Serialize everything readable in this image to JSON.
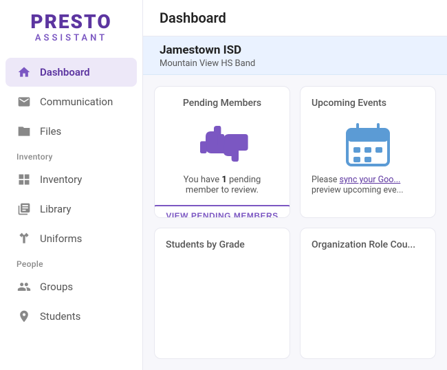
{
  "logo": {
    "name": "PRESTO",
    "sub": "ASSISTANT"
  },
  "sidebar": {
    "items": [
      {
        "id": "dashboard",
        "label": "Dashboard",
        "icon": "home",
        "active": true,
        "section": ""
      },
      {
        "id": "communication",
        "label": "Communication",
        "icon": "mail",
        "active": false,
        "section": ""
      },
      {
        "id": "files",
        "label": "Files",
        "icon": "folder",
        "active": false,
        "section": ""
      }
    ],
    "inventory_section": "Inventory",
    "inventory_items": [
      {
        "id": "inventory",
        "label": "Inventory",
        "icon": "grid"
      },
      {
        "id": "library",
        "label": "Library",
        "icon": "book"
      },
      {
        "id": "uniforms",
        "label": "Uniforms",
        "icon": "tshirt"
      }
    ],
    "people_section": "People",
    "people_items": [
      {
        "id": "groups",
        "label": "Groups",
        "icon": "users"
      },
      {
        "id": "students",
        "label": "Students",
        "icon": "student"
      }
    ]
  },
  "main": {
    "header_title": "Dashboard",
    "org_name": "Jamestown ISD",
    "org_sub": "Mountain View HS Band",
    "cards": [
      {
        "id": "pending-members",
        "title": "Pending Members",
        "pending_text_prefix": "You have ",
        "pending_count": "1",
        "pending_text_suffix": " pending member to review.",
        "button_label": "VIEW PENDING MEMBERS"
      },
      {
        "id": "upcoming-events",
        "title": "Upcoming Events",
        "sync_text": "Please ",
        "sync_link": "sync your Goo...",
        "sync_text2": "preview upcoming eve..."
      },
      {
        "id": "students-by-grade",
        "title": "Students by Grade"
      },
      {
        "id": "org-role",
        "title": "Organization Role Cou..."
      }
    ]
  }
}
